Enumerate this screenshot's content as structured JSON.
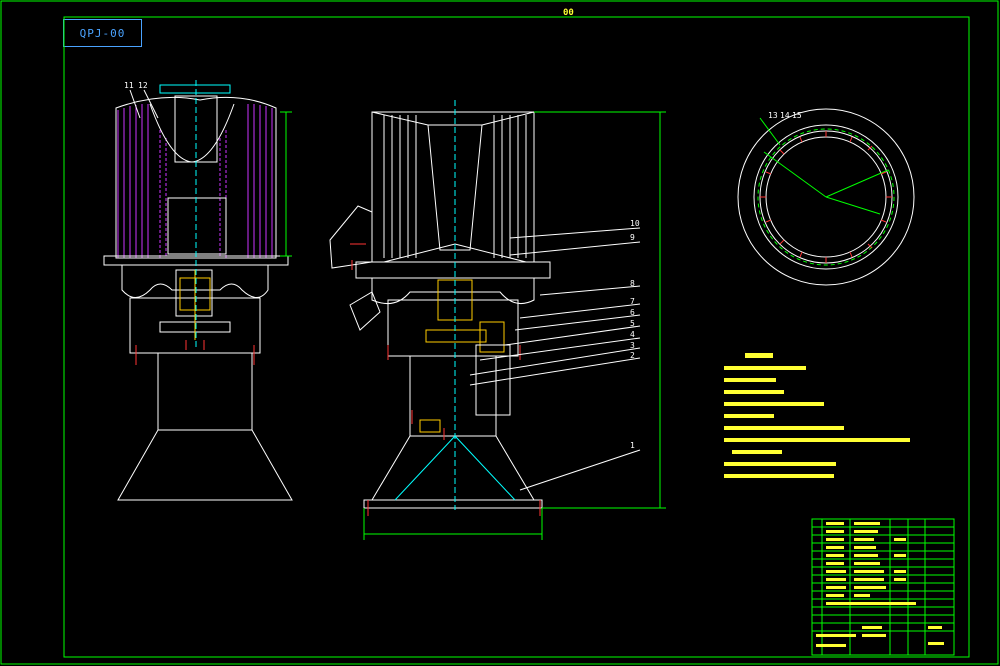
{
  "drawing": {
    "code_tag": "QPJ-00",
    "top_label": "00"
  },
  "left_view": {
    "callouts": [
      "11",
      "12"
    ]
  },
  "center_view": {
    "callouts": [
      "10",
      "9",
      "8",
      "7",
      "6",
      "5",
      "4",
      "3",
      "2",
      "1"
    ]
  },
  "right_view": {
    "callouts": [
      "13",
      "14",
      "15"
    ]
  },
  "colors": {
    "frame": "#00ff00",
    "outline": "#ffffff",
    "hatch": "#cc33ff",
    "accent": "#00ffff",
    "dim": "#ff3333",
    "fill_yellow": "#ffcc00"
  }
}
